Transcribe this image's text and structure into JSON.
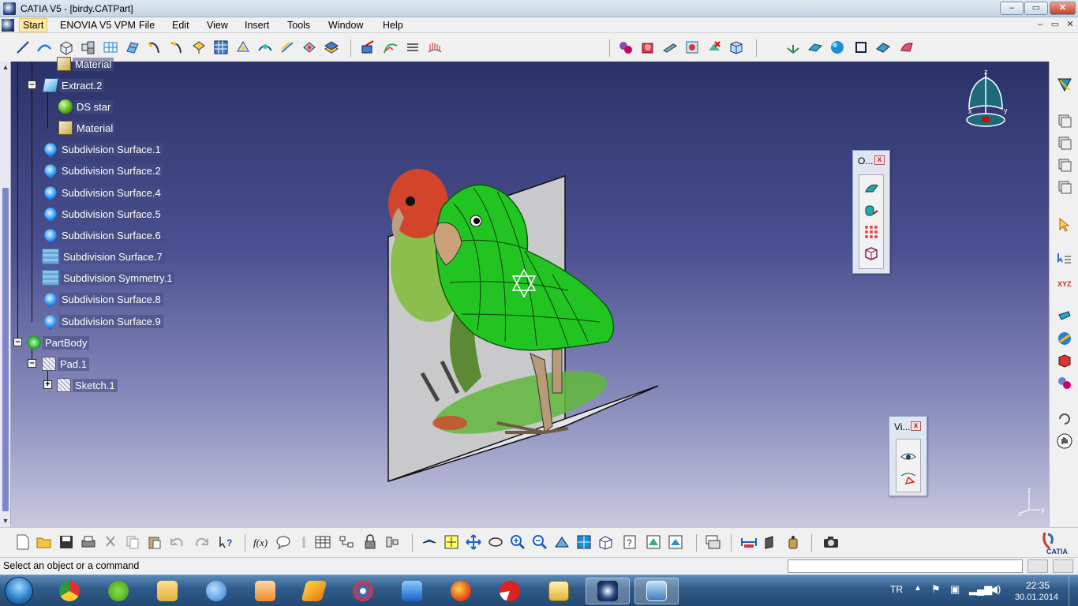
{
  "window": {
    "title": "CATIA V5 - [birdy.CATPart]",
    "min": "–",
    "max": "▭",
    "close": "✕"
  },
  "menu": {
    "items": [
      "Start",
      "ENOVIA V5 VPM",
      "File",
      "Edit",
      "View",
      "Insert",
      "Tools",
      "Window",
      "Help"
    ],
    "active": "Start",
    "mdi": [
      "–",
      "▭",
      "✕"
    ]
  },
  "tree": {
    "nodes": [
      {
        "label": "Material",
        "icon": "material-icon"
      },
      {
        "label": "Extract.2",
        "icon": "extract-icon"
      },
      {
        "label": "DS star",
        "icon": "sphere-icon"
      },
      {
        "label": "Material",
        "icon": "material-icon"
      },
      {
        "label": "Subdivision Surface.1",
        "icon": "subdivision-surface-icon"
      },
      {
        "label": "Subdivision Surface.2",
        "icon": "subdivision-surface-icon"
      },
      {
        "label": "Subdivision Surface.4",
        "icon": "subdivision-surface-icon"
      },
      {
        "label": "Subdivision Surface.5",
        "icon": "subdivision-surface-icon"
      },
      {
        "label": "Subdivision Surface.6",
        "icon": "subdivision-surface-icon"
      },
      {
        "label": "Subdivision Surface.7",
        "icon": "subdivision-grid-icon"
      },
      {
        "label": "Subdivision Symmetry.1",
        "icon": "subdivision-grid-icon"
      },
      {
        "label": "Subdivision Surface.8",
        "icon": "subdivision-surface-icon"
      },
      {
        "label": "Subdivision Surface.9",
        "icon": "subdivision-surface-icon"
      },
      {
        "label": "PartBody",
        "icon": "partbody-icon"
      },
      {
        "label": "Pad.1",
        "icon": "pad-icon"
      },
      {
        "label": "Sketch.1",
        "icon": "sketch-icon"
      }
    ]
  },
  "compass": {
    "x": "x",
    "y": "y",
    "z": "z"
  },
  "axis_triad": {
    "x": "x",
    "y": "y",
    "z": "z"
  },
  "floating_toolbars": {
    "operations": {
      "title": "O..."
    },
    "view": {
      "title": "Vi..."
    }
  },
  "status": {
    "message": "Select an object or a command"
  },
  "taskbar": {
    "language": "TR",
    "time": "22:35",
    "date": "30.01.2014"
  },
  "logo": "CATIA"
}
